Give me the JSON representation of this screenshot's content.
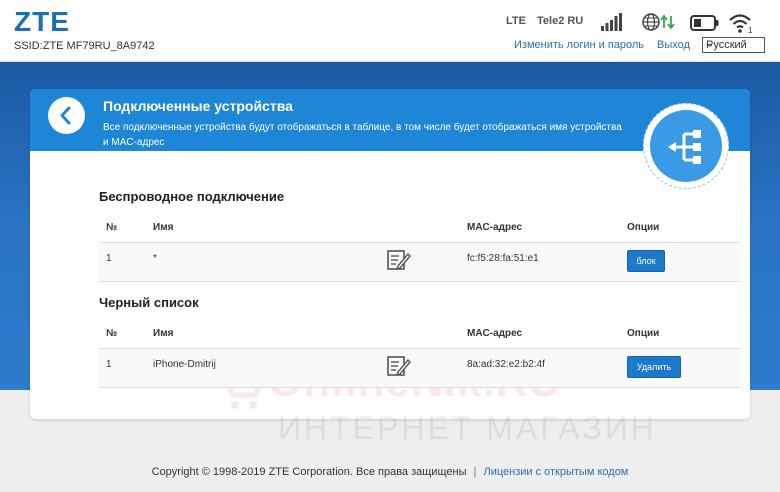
{
  "header": {
    "logo": "ZTE",
    "ssid": "SSID:ZTE MF79RU_8A9742",
    "network_type": "LTE",
    "operator": "Tele2 RU",
    "change_login_link": "Изменить логин и пароль",
    "logout_link": "Выход",
    "language": "Русский",
    "icons": [
      "signal-icon",
      "globe-icon",
      "battery-icon",
      "wifi-icon"
    ]
  },
  "panel": {
    "title": "Подключенные устройства",
    "description": "Все подключенные устройства будут отображаться в таблице, в том числе будет отображаться имя устройства и MAC-адрес"
  },
  "wireless": {
    "title": "Беспроводное подключение",
    "columns": {
      "num": "№",
      "name": "Имя",
      "mac": "MAC-адрес",
      "options": "Опции"
    },
    "rows": [
      {
        "num": "1",
        "name": "*",
        "mac": "fc:f5:28:fa:51:e1",
        "action": "блок"
      }
    ]
  },
  "blacklist": {
    "title": "Черный список",
    "columns": {
      "num": "№",
      "name": "Имя",
      "mac": "MAC-адрес",
      "options": "Опции"
    },
    "rows": [
      {
        "num": "1",
        "name": "iPhone-Dmitrij",
        "mac": "8a:ad:32:e2:b2:4f",
        "action": "Удалить"
      }
    ]
  },
  "watermark": {
    "brand": "OnlineNik.RU",
    "tagline": "ИНТЕРНЕТ МАГАЗИН"
  },
  "footer": {
    "copyright": "Copyright © 1998-2019 ZTE Corporation. Все права защищены",
    "separator": "|",
    "license_link": "Лицензии с открытым кодом"
  },
  "colors": {
    "brand_blue": "#1c6fb5",
    "header_blue": "#1e86d6",
    "button_blue": "#1d79c9",
    "band_blue": "#2a73c5"
  }
}
